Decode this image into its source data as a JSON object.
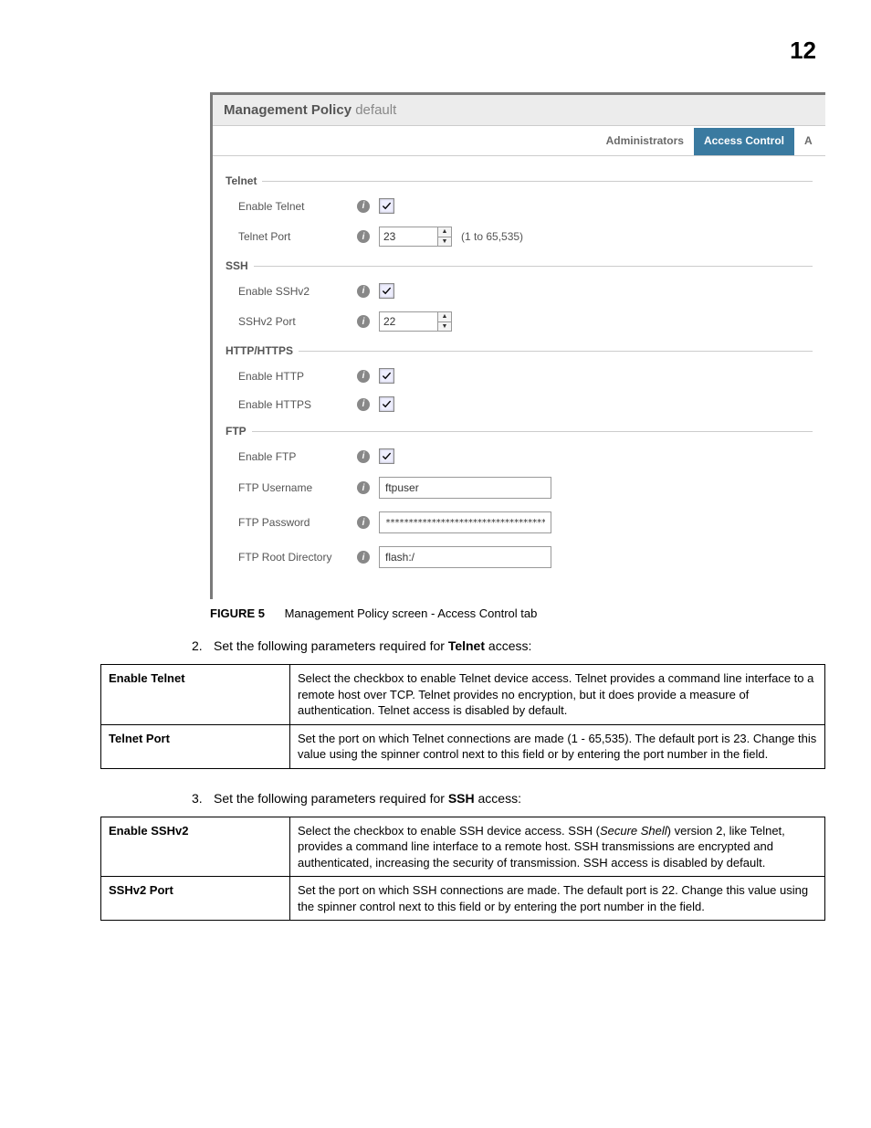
{
  "page_number": "12",
  "screenshot": {
    "title_label": "Management Policy",
    "title_value": "default",
    "tabs": {
      "admin": "Administrators",
      "access": "Access Control",
      "partial": "A"
    },
    "sections": {
      "telnet": {
        "heading": "Telnet",
        "enable_label": "Enable Telnet",
        "port_label": "Telnet Port",
        "port_value": "23",
        "port_hint": "(1 to 65,535)"
      },
      "ssh": {
        "heading": "SSH",
        "enable_label": "Enable SSHv2",
        "port_label": "SSHv2 Port",
        "port_value": "22"
      },
      "http": {
        "heading": "HTTP/HTTPS",
        "http_label": "Enable HTTP",
        "https_label": "Enable HTTPS"
      },
      "ftp": {
        "heading": "FTP",
        "enable_label": "Enable FTP",
        "user_label": "FTP Username",
        "user_value": "ftpuser",
        "pass_label": "FTP Password",
        "pass_value": "************************************",
        "root_label": "FTP Root Directory",
        "root_value": "flash:/"
      }
    }
  },
  "figure": {
    "label": "FIGURE 5",
    "caption": "Management Policy screen - Access Control tab"
  },
  "step2": {
    "num": "2.",
    "text_before": "Set the following parameters required for ",
    "bold": "Telnet",
    "text_after": " access:"
  },
  "table_telnet": {
    "r1": {
      "name": "Enable Telnet",
      "desc": "Select the checkbox to enable Telnet device access. Telnet provides a command line interface to a remote host over TCP. Telnet provides no encryption, but it does provide a measure of authentication. Telnet access is disabled by default."
    },
    "r2": {
      "name": "Telnet Port",
      "desc": "Set the port on which Telnet connections are made (1 - 65,535). The default port is 23. Change this value using the spinner control next to this field or by entering the port number in the field."
    }
  },
  "step3": {
    "num": "3.",
    "text_before": "Set the following parameters required for ",
    "bold": "SSH",
    "text_after": " access:"
  },
  "table_ssh": {
    "r1": {
      "name": "Enable SSHv2",
      "desc_a": "Select the checkbox to enable SSH device access. SSH (",
      "desc_em": "Secure Shell",
      "desc_b": ") version 2, like Telnet, provides a command line interface to a remote host. SSH transmissions are encrypted and authenticated, increasing the security of transmission. SSH access is disabled by default."
    },
    "r2": {
      "name": "SSHv2 Port",
      "desc": "Set the port on which SSH connections are made. The default port is 22. Change this value using the spinner control next to this field or by entering the port number in the field."
    }
  }
}
